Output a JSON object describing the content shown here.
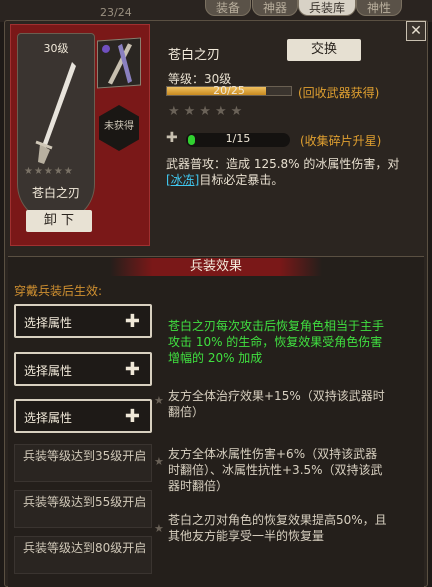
{
  "topbar": {
    "ghost_text": "23/24",
    "tabs": [
      "装备",
      "神器",
      "兵装库",
      "神性"
    ]
  },
  "banner": {
    "level_badge": "30级",
    "weapon_name": "苍白之刃",
    "unequip_label": "卸  下",
    "not_obtained": "未获得"
  },
  "weapon": {
    "title": "苍白之刃",
    "exchange_label": "交换",
    "level_label": "等级：30级",
    "xp_value": 20,
    "xp_max": 25,
    "xp_text": "20/25",
    "xp_hint": "(回收武器获得)",
    "stars": "★★★★★",
    "shards_value": 1,
    "shards_max": 15,
    "shards_text": "1/15",
    "shards_hint": "(收集碎片升星)",
    "desc_pre": "武器普攻：造成 125.8% 的冰属性伤害，对",
    "desc_link": "[冰冻]",
    "desc_post": "目标必定暴击。"
  },
  "section": {
    "title": "兵装效果",
    "hint": "穿戴兵装后生效:",
    "slots": [
      "选择属性",
      "选择属性",
      "选择属性"
    ],
    "locked": [
      "兵装等级达到35级开启",
      "兵装等级达到55级开启",
      "兵装等级达到80级开启"
    ],
    "effects": [
      "苍白之刃每次攻击后恢复角色相当于主手攻击 10% 的生命，恢复效果受角色伤害增幅的 20% 加成",
      "友方全体治疗效果+15%（双持该武器时翻倍）",
      "友方全体冰属性伤害+6%（双持该武器时翻倍）、冰属性抗性+3.5%（双持该武器时翻倍）",
      "苍白之刃对角色的恢复效果提高50%，且其他友方能享受一半的恢复量"
    ]
  },
  "close_icon": "close-icon",
  "colors": {
    "accent_red": "#7a1818",
    "hint_orange": "#e0a030",
    "active_green": "#40e040",
    "link_blue": "#40c8f0"
  }
}
